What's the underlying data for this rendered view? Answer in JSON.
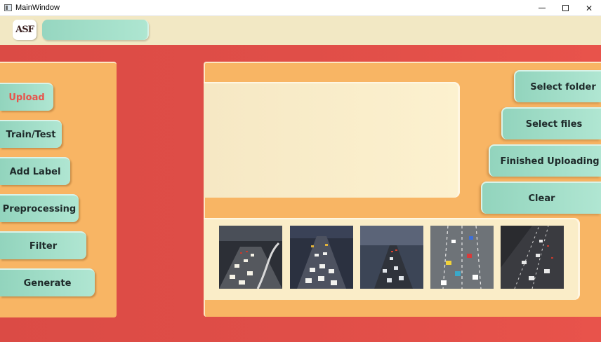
{
  "window": {
    "title": "MainWindow",
    "minimize_glyph": "",
    "maximize_glyph": "",
    "close_glyph": "✕"
  },
  "header": {
    "logo_text": "ASF",
    "logo_icon": "app-logo-icon"
  },
  "sidebar": {
    "items": [
      {
        "label": "Upload",
        "active": true
      },
      {
        "label": "Train/Test",
        "active": false
      },
      {
        "label": "Add Label",
        "active": false
      },
      {
        "label": "Preprocessing",
        "active": false
      },
      {
        "label": "Filter",
        "active": false
      },
      {
        "label": "Generate",
        "active": false
      }
    ]
  },
  "actions": {
    "select_folder": "Select folder",
    "select_files": "Select files",
    "finished_uploading": "Finished Uploading",
    "clear": "Clear"
  },
  "gallery": {
    "images": [
      {
        "name": "highway-traffic-image-1"
      },
      {
        "name": "highway-traffic-image-2"
      },
      {
        "name": "highway-traffic-image-3"
      },
      {
        "name": "highway-traffic-image-4"
      },
      {
        "name": "highway-traffic-image-5"
      }
    ]
  },
  "colors": {
    "accent_red": "#e8534b",
    "panel_orange": "#f8b564",
    "button_mint": "#a6e0cb",
    "header_cream": "#f2e8c4"
  }
}
